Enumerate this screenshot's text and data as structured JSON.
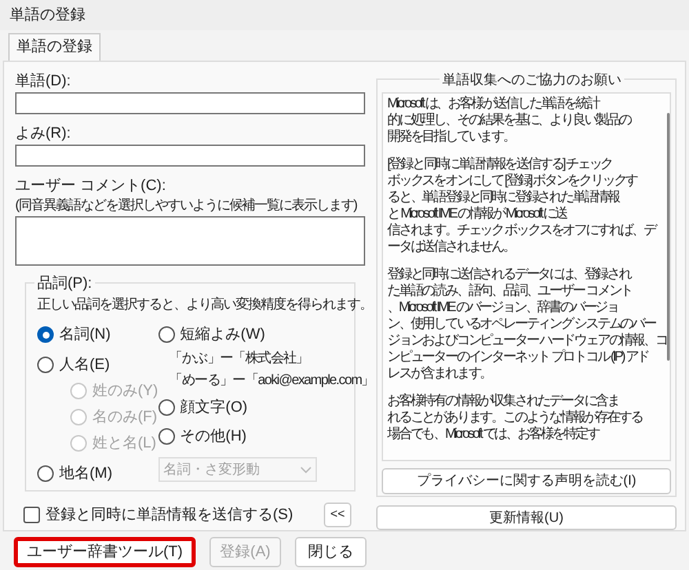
{
  "window": {
    "title": "単語の登録"
  },
  "tabs": [
    {
      "label": "単語の登録",
      "selected": true
    }
  ],
  "word": {
    "label": "単語(D):"
  },
  "reading": {
    "label": "よみ(R):"
  },
  "comment": {
    "label": "ユーザー コメント(C):",
    "note": "(同音異義語などを選択しやすいように候補一覧に表示します)"
  },
  "pos": {
    "legend": "品詞(P):",
    "description": "正しい品詞を選択すると、より高い変換精度を得られます。",
    "left": [
      {
        "label": "名詞(N)",
        "selected": true
      },
      {
        "label": "人名(E)",
        "selected": false,
        "children": [
          {
            "label": "姓のみ(Y)",
            "selected": false,
            "disabled": true
          },
          {
            "label": "名のみ(F)",
            "selected": false,
            "disabled": true
          },
          {
            "label": "姓と名(L)",
            "selected": false,
            "disabled": true
          }
        ]
      },
      {
        "label": "地名(M)",
        "selected": false
      }
    ],
    "right": [
      {
        "label": "短縮よみ(W)",
        "selected": false,
        "examples": [
          "「かぶ」ー「株式会社」",
          "「めーる」ー「aoki@example.com」"
        ]
      },
      {
        "label": "顔文字(O)",
        "selected": false
      },
      {
        "label": "その他(H)",
        "selected": false
      }
    ],
    "dropdown": {
      "value": "名詞・さ変形動",
      "disabled": true
    }
  },
  "send_checkbox": {
    "label": "登録と同時に単語情報を送信する(S)",
    "checked": false
  },
  "collapse_button": "<<",
  "info": {
    "legend": "単語収集へのご協力のお願い",
    "paragraphs": [
      [
        "Microsoft は、お客様が送信した単語を統計",
        "的に処理し、その結果を基に、より良い製品の",
        "開発を目指しています。"
      ],
      [
        "[登録と同時に単語情報を送信する] チェック",
        "ボックスをオンにして [登録] ボタンをクリックす",
        "ると、単語登録と同時に登録された単語情報",
        "と Microsoft IME の情報が Microsoft に送",
        "信されます。チェック ボックスをオフにすれば、デ",
        "ータは送信されません。"
      ],
      [
        "登録と同時に送信されるデータには、登録され",
        "た単語の読み、語句、品詞、ユーザー コメント",
        "、Microsoft IME のバージョン、辞書のバージョ",
        "ン、使用しているオペレーティング システムのバー",
        "ジョンおよびコンピューター ハードウェアの情報、コ",
        "ンピューターのインターネット プロトコル (IP) アド",
        "レスが含まれます。"
      ],
      [
        "お客様特有の情報が収集されたデータに含ま",
        "れることがあります。このような情報が存在する",
        "場合でも、Microsoft では、お客様を特定す"
      ]
    ],
    "privacy_button": "プライバシーに関する声明を読む(I)"
  },
  "update_button": "更新情報(U)",
  "buttons": [
    {
      "label": "ユーザー辞書ツール(T)",
      "disabled": false,
      "highlighted": true
    },
    {
      "label": "登録(A)",
      "disabled": true,
      "highlighted": false
    },
    {
      "label": "閉じる",
      "disabled": false,
      "highlighted": false
    }
  ]
}
